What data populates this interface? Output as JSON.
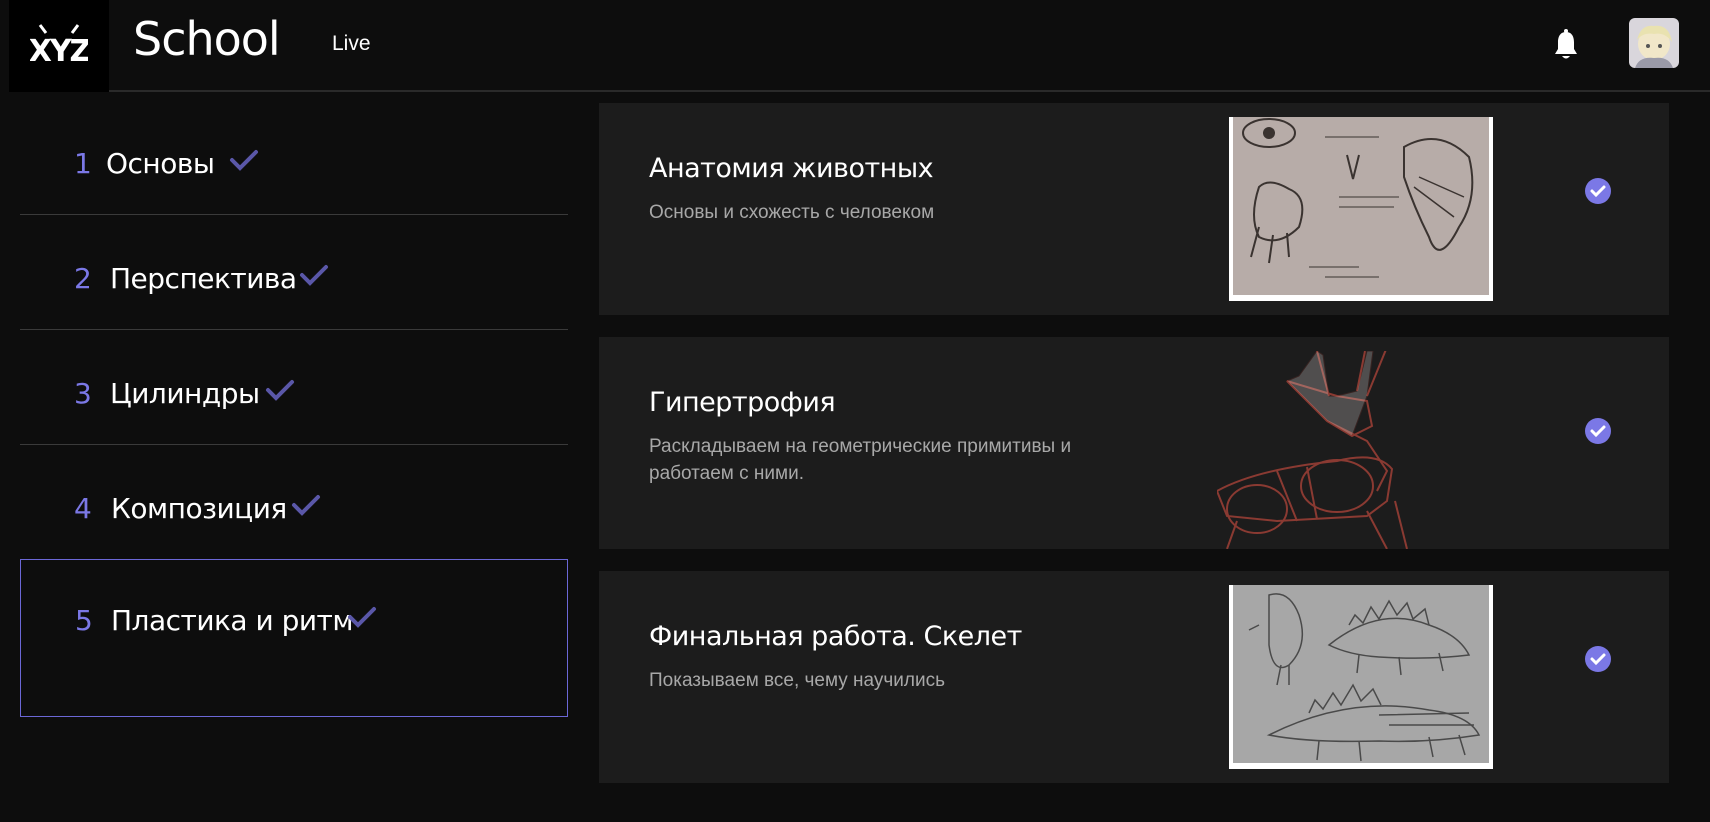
{
  "header": {
    "logo_text": "XYZ",
    "brand": "School",
    "nav_live": "Live"
  },
  "sidebar": {
    "items": [
      {
        "num": "1",
        "label": "Основы"
      },
      {
        "num": "2",
        "label": "Перспектива"
      },
      {
        "num": "3",
        "label": "Цилиндры"
      },
      {
        "num": "4",
        "label": "Композиция"
      },
      {
        "num": "5",
        "label": "Пластика и ритм"
      }
    ],
    "active_index": 4
  },
  "lessons": [
    {
      "title": "Анатомия животных",
      "desc": "Основы и схожесть с человеком",
      "completed": true
    },
    {
      "title": "Гипертрофия",
      "desc": "Раскладываем на геометрические примитивы и работаем с ними.",
      "completed": true
    },
    {
      "title": "Финальная работа. Скелет",
      "desc": "Показываем все, чему научились",
      "completed": true
    }
  ],
  "colors": {
    "accent": "#7b78e6",
    "check_dim": "#5a57a8",
    "card_bg": "#1c1c1c",
    "page_bg": "#0d0d0d"
  }
}
